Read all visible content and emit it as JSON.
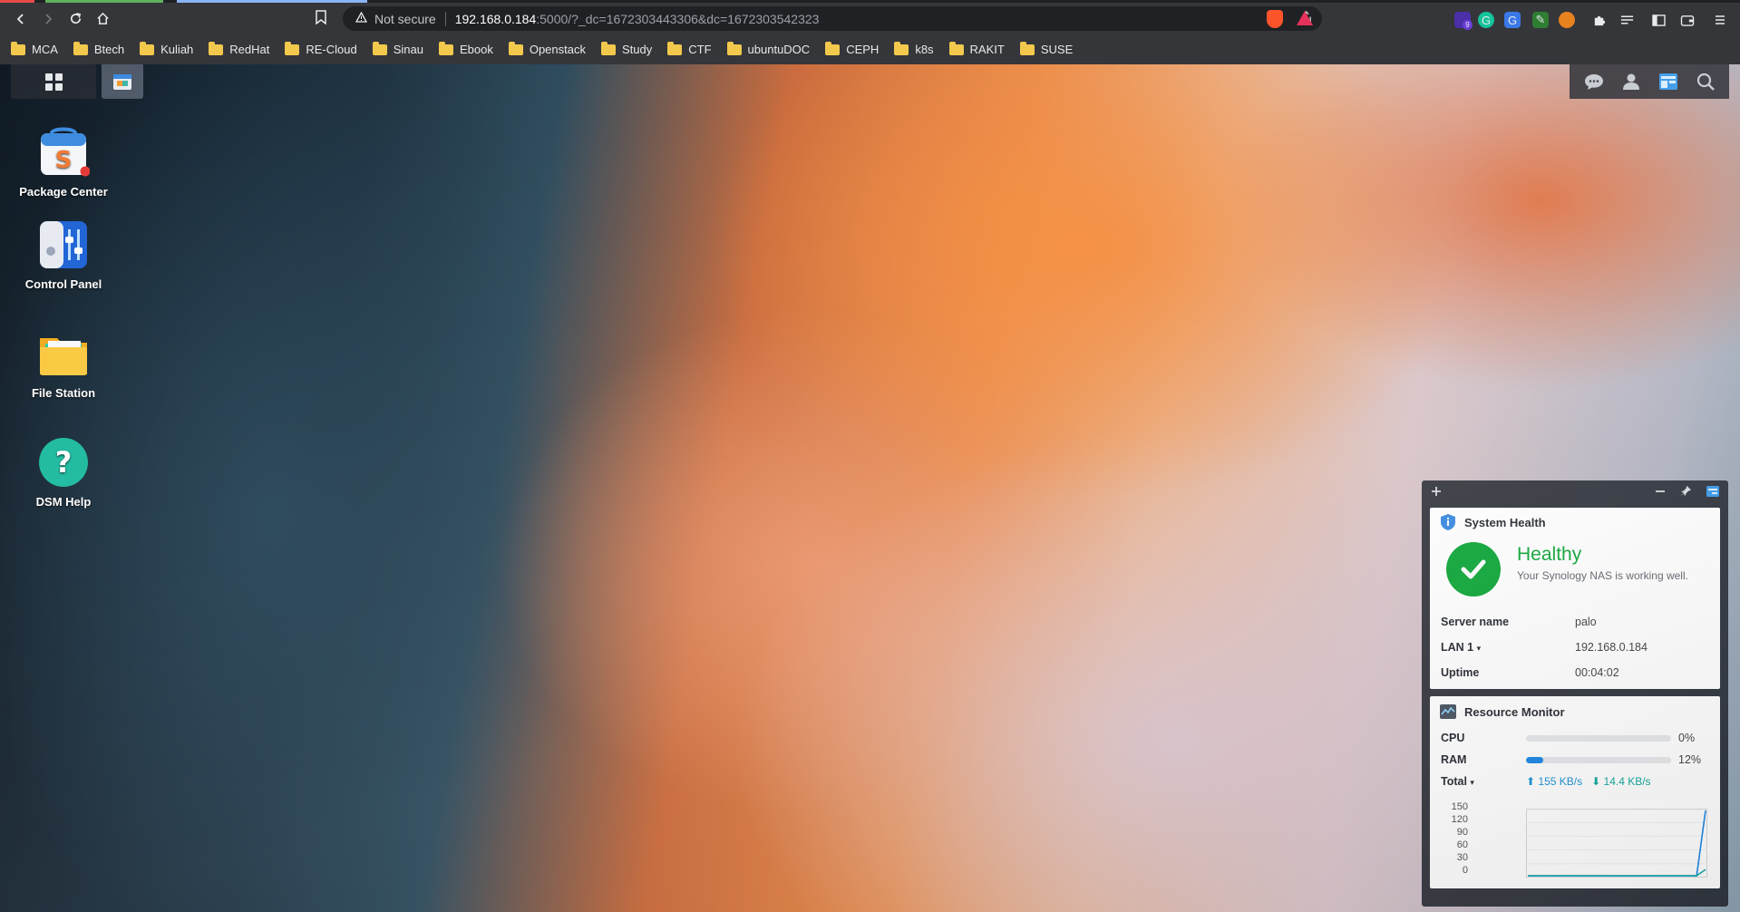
{
  "browser": {
    "security_label": "Not secure",
    "url_host": "192.168.0.184",
    "url_path": ":5000/?_dc=1672303443306&dc=1672303542323",
    "extension_badge": "9",
    "bookmarks": [
      "MCA",
      "Btech",
      "Kuliah",
      "RedHat",
      "RE-Cloud",
      "Sinau",
      "Ebook",
      "Openstack",
      "Study",
      "CTF",
      "ubuntuDOC",
      "CEPH",
      "k8s",
      "RAKIT",
      "SUSE"
    ]
  },
  "desktop": {
    "icons": [
      {
        "label": "Package Center"
      },
      {
        "label": "Control Panel"
      },
      {
        "label": "File Station"
      },
      {
        "label": "DSM Help"
      }
    ]
  },
  "system_health": {
    "title": "System Health",
    "status": "Healthy",
    "description": "Your Synology NAS is working well.",
    "rows": [
      {
        "key": "Server name",
        "value": "palo"
      },
      {
        "key": "LAN 1",
        "value": "192.168.0.184"
      },
      {
        "key": "Uptime",
        "value": "00:04:02"
      }
    ]
  },
  "resource_monitor": {
    "title": "Resource Monitor",
    "cpu_label": "CPU",
    "cpu_percent": 0,
    "cpu_text": "0%",
    "ram_label": "RAM",
    "ram_percent": 12,
    "ram_text": "12%",
    "total_label": "Total",
    "upload": "155 KB/s",
    "download": "14.4 KB/s",
    "chart_yticks": [
      "150",
      "120",
      "90",
      "60",
      "30",
      "0"
    ]
  },
  "chart_data": {
    "type": "line",
    "title": "",
    "xlabel": "",
    "ylabel": "",
    "ylim": [
      0,
      150
    ],
    "series": [
      {
        "color": "#1e88e5",
        "values": [
          0,
          0,
          0,
          0,
          0,
          0,
          0,
          0,
          0,
          0,
          0,
          0,
          0,
          0,
          0,
          0,
          0,
          0,
          0,
          0,
          155
        ]
      },
      {
        "color": "#14a9a5",
        "values": [
          0,
          0,
          0,
          0,
          0,
          0,
          0,
          0,
          0,
          0,
          0,
          0,
          0,
          0,
          0,
          0,
          0,
          0,
          0,
          0,
          14.4
        ]
      }
    ]
  }
}
